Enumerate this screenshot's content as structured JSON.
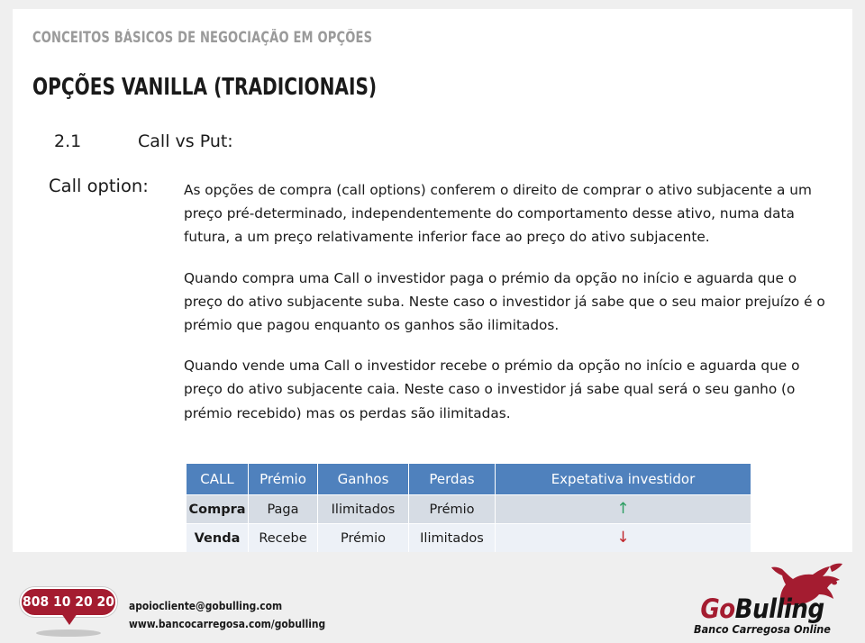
{
  "slide": {
    "eyebrow": "CONCEITOS BÁSICOS DE NEGOCIAÇÃO EM OPÇÕES",
    "title": "OPÇÕES VANILLA (TRADICIONAIS)",
    "section_number": "2.1",
    "section_title": "Call vs Put:",
    "term_label": "Call option:",
    "paragraphs": [
      "As opções de compra (call options) conferem o direito de comprar o ativo subjacente a um preço pré-determinado, independentemente do comportamento desse ativo, numa data futura, a um preço relativamente inferior face ao preço do ativo subjacente.",
      "Quando compra uma Call o investidor paga o prémio da opção no início e aguarda que o preço do ativo subjacente suba. Neste caso o investidor já sabe que o seu maior prejuízo é o prémio que pagou enquanto os ganhos são ilimitados.",
      "Quando vende uma Call o investidor recebe o prémio da opção no início e aguarda que o preço do ativo subjacente caia. Neste caso o investidor já sabe qual será o seu ganho (o prémio recebido) mas os perdas são ilimitadas."
    ]
  },
  "table": {
    "headers": [
      "CALL",
      "Prémio",
      "Ganhos",
      "Perdas",
      "Expetativa investidor"
    ],
    "rows": [
      {
        "cells": [
          "Compra",
          "Paga",
          "Ilimitados",
          "Prémio"
        ],
        "expectation": "↑",
        "expectation_name": "arrow-up-icon"
      },
      {
        "cells": [
          "Venda",
          "Recebe",
          "Prémio",
          "Ilimitados"
        ],
        "expectation": "↓",
        "expectation_name": "arrow-down-icon"
      }
    ]
  },
  "footer": {
    "phone": "808 10 20 20",
    "email": "apoiocliente@gobulling.com",
    "website": "www.bancocarregosa.com/gobulling",
    "brand_go": "Go",
    "brand_bulling": "Bulling",
    "brand_tagline": "Banco Carregosa Online"
  },
  "colors": {
    "table_header": "#4f81bd",
    "table_row_a": "#d6dce4",
    "table_row_b": "#edf1f7",
    "brand_red": "#a41c30",
    "arrow_up": "#2e9e63",
    "arrow_down": "#c0242a",
    "eyebrow_gray": "#9a9a9a",
    "page_background": "#efefef"
  }
}
